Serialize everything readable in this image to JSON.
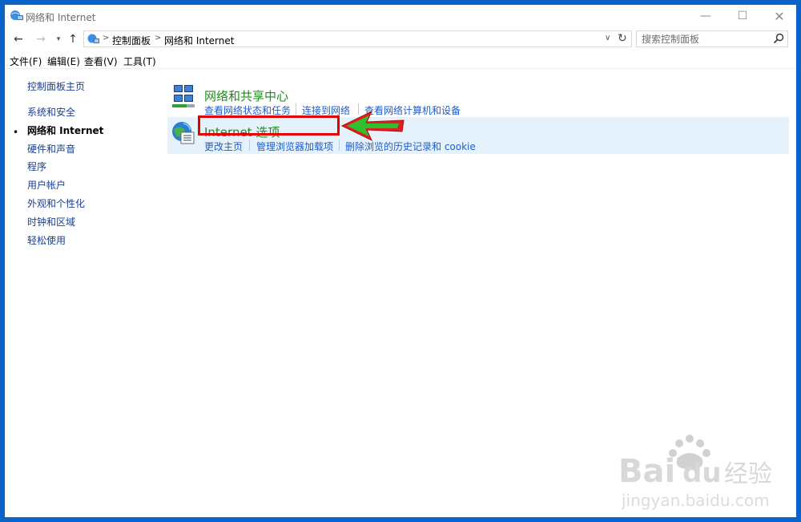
{
  "window": {
    "title": "网络和 Internet",
    "controls": {
      "minimize": "—",
      "maximize": "☐",
      "close": "✕"
    }
  },
  "nav": {
    "back": "←",
    "forward": "→",
    "recent": "▾",
    "up": "↑",
    "breadcrumbs": [
      "控制面板",
      "网络和 Internet"
    ],
    "crumb_sep": ">",
    "dropdown": "∨",
    "refresh": "↻"
  },
  "search": {
    "placeholder": "搜索控制面板"
  },
  "menubar": [
    "文件(F)",
    "编辑(E)",
    "查看(V)",
    "工具(T)"
  ],
  "sidebar": {
    "home": "控制面板主页",
    "items": [
      {
        "label": "系统和安全",
        "active": false
      },
      {
        "label": "网络和 Internet",
        "active": true
      },
      {
        "label": "硬件和声音",
        "active": false
      },
      {
        "label": "程序",
        "active": false
      },
      {
        "label": "用户帐户",
        "active": false
      },
      {
        "label": "外观和个性化",
        "active": false
      },
      {
        "label": "时钟和区域",
        "active": false
      },
      {
        "label": "轻松使用",
        "active": false
      }
    ],
    "bullet": "•"
  },
  "categories": [
    {
      "title": "网络和共享中心",
      "icon": "network-sharing-icon",
      "tasks": [
        "查看网络状态和任务",
        "连接到网络",
        "查看网络计算机和设备"
      ]
    },
    {
      "title": "Internet 选项",
      "icon": "internet-options-icon",
      "tasks": [
        "更改主页",
        "管理浏览器加载项",
        "删除浏览的历史记录和 cookie"
      ]
    }
  ],
  "watermark": {
    "brand": "Bai",
    "brand2": "du",
    "cn": "经验",
    "url": "jingyan.baidu.com"
  },
  "colors": {
    "frame": "#0a63c9",
    "link": "#1e5ec9",
    "category_title": "#1e8b1e",
    "highlight_row": "#e5f1fb",
    "annotation_red": "#e00000",
    "annotation_arrow": "#2fbf2f"
  }
}
